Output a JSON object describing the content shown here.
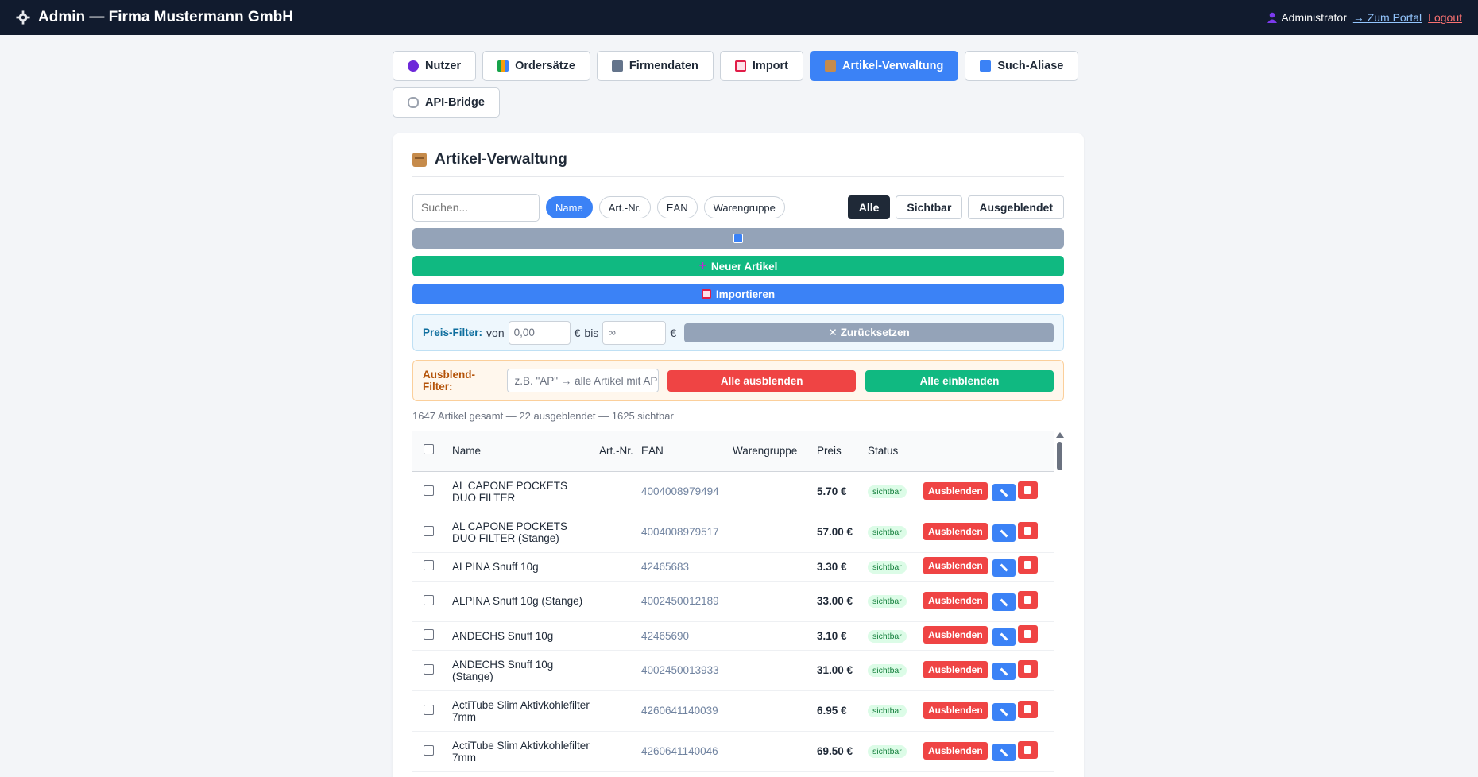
{
  "topbar": {
    "title": "Admin — Firma Mustermann GmbH",
    "user": "Administrator",
    "portal_link": "→ Zum Portal",
    "logout": "Logout"
  },
  "tabs": [
    {
      "label": "Nutzer",
      "icon": "users-icon",
      "color": "#6d28d9"
    },
    {
      "label": "Ordersätze",
      "icon": "books-icon",
      "color": "#16a34a"
    },
    {
      "label": "Firmendaten",
      "icon": "building-icon",
      "color": "#64748b"
    },
    {
      "label": "Import",
      "icon": "inbox-tray-icon",
      "color": "#e11d48"
    },
    {
      "label": "Artikel-Verwaltung",
      "icon": "package-icon",
      "color": "#c68b4b",
      "active": true
    },
    {
      "label": "Such-Aliase",
      "icon": "abc-icon",
      "color": "#3b82f6"
    },
    {
      "label": "API-Bridge",
      "icon": "link-icon",
      "color": "#9ca3af"
    }
  ],
  "card": {
    "title": "Artikel-Verwaltung",
    "search_placeholder": "Suchen...",
    "search_modes": [
      "Name",
      "Art.-Nr.",
      "EAN",
      "Warengruppe"
    ],
    "visibility": [
      "Alle",
      "Sichtbar",
      "Ausgeblendet"
    ],
    "new_article": "Neuer Artikel",
    "import": "Importieren",
    "price_filter": {
      "label": "Preis-Filter:",
      "from": "von",
      "from_value": "0,00",
      "currency": "€",
      "to": "bis",
      "to_value": "∞",
      "reset": "Zurücksetzen"
    },
    "hide_filter": {
      "label": "Ausblend-Filter:",
      "placeholder": "z.B. \"AP\" → alle Artikel mit AP",
      "hide_all": "Alle ausblenden",
      "show_all": "Alle einblenden"
    },
    "summary": "1647 Artikel gesamt — 22 ausgeblendet — 1625 sichtbar"
  },
  "table": {
    "headers": [
      "Name",
      "Art.-Nr.",
      "EAN",
      "Warengruppe",
      "Preis",
      "Status"
    ],
    "action_hide": "Ausblenden",
    "rows": [
      {
        "name": "AL CAPONE POCKETS DUO FILTER",
        "artnr": "",
        "ean": "4004008979494",
        "group": "",
        "price": "5.70 €",
        "status": "sichtbar"
      },
      {
        "name": "AL CAPONE POCKETS DUO FILTER (Stange)",
        "artnr": "",
        "ean": "4004008979517",
        "group": "",
        "price": "57.00 €",
        "status": "sichtbar"
      },
      {
        "name": "ALPINA Snuff 10g",
        "artnr": "",
        "ean": "42465683",
        "group": "",
        "price": "3.30 €",
        "status": "sichtbar"
      },
      {
        "name": "ALPINA Snuff 10g (Stange)",
        "artnr": "",
        "ean": "4002450012189",
        "group": "",
        "price": "33.00 €",
        "status": "sichtbar"
      },
      {
        "name": "ANDECHS Snuff 10g",
        "artnr": "",
        "ean": "42465690",
        "group": "",
        "price": "3.10 €",
        "status": "sichtbar"
      },
      {
        "name": "ANDECHS Snuff 10g (Stange)",
        "artnr": "",
        "ean": "4002450013933",
        "group": "",
        "price": "31.00 €",
        "status": "sichtbar"
      },
      {
        "name": "ActiTube Slim Aktivkohlefilter 7mm",
        "artnr": "",
        "ean": "4260641140039",
        "group": "",
        "price": "6.95 €",
        "status": "sichtbar"
      },
      {
        "name": "ActiTube Slim Aktivkohlefilter 7mm",
        "artnr": "",
        "ean": "4260641140046",
        "group": "",
        "price": "69.50 €",
        "status": "sichtbar"
      }
    ]
  },
  "colors": {
    "topbar": "#111b2e",
    "primary": "#3b82f6",
    "success": "#10b981",
    "danger": "#ef4444"
  }
}
